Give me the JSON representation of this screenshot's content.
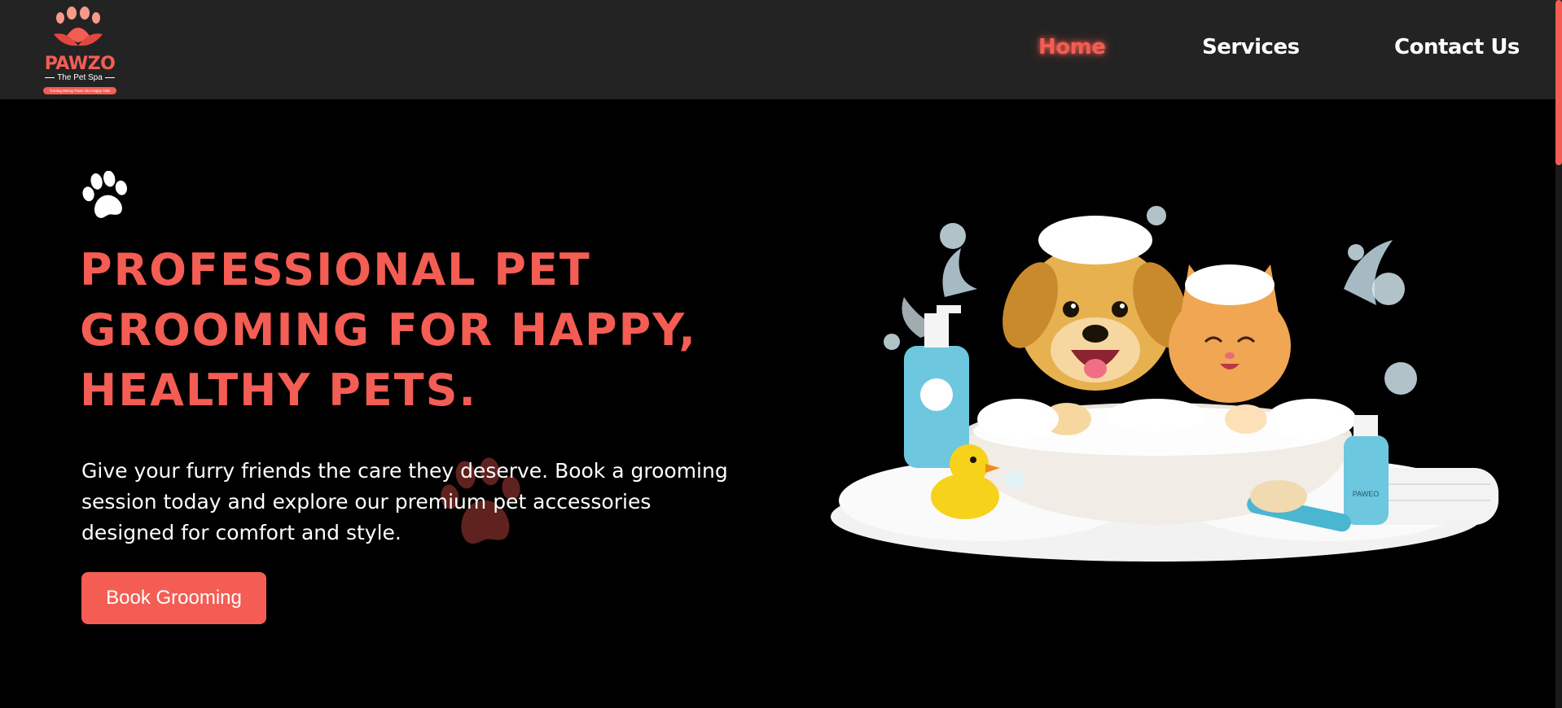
{
  "brand": {
    "name": "PAWZO",
    "subtitle": "The Pet Spa",
    "tagline": "Turning Messy Paws into Happy Tails",
    "accent_color": "#f45d53"
  },
  "nav": {
    "items": [
      {
        "label": "Home",
        "active": true
      },
      {
        "label": "Services",
        "active": false
      },
      {
        "label": "Contact Us",
        "active": false
      }
    ]
  },
  "hero": {
    "icon": "paw-icon",
    "title": "Professional Pet Grooming for Happy, Healthy Pets.",
    "description": "Give your furry friends the care they deserve. Book a grooming session today and explore our premium pet accessories designed for comfort and style.",
    "cta_label": "Book Grooming",
    "image": {
      "icon": "pets-bath-illustration",
      "bottle_label": "PAWEO"
    }
  }
}
